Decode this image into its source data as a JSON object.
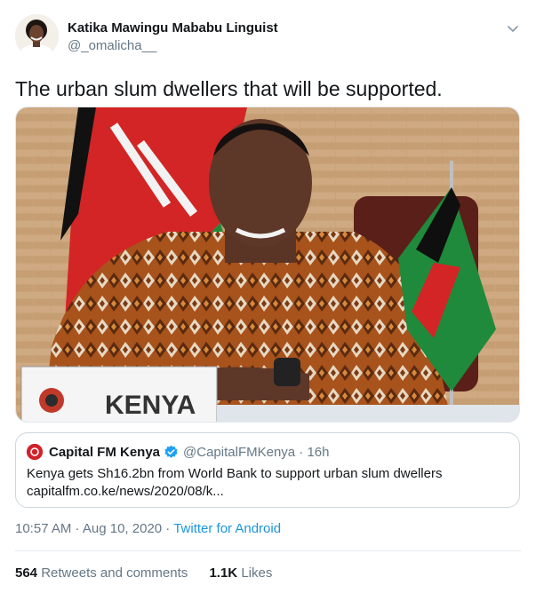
{
  "author": {
    "display_name": "Katika Mawingu Mababu Linguist",
    "handle": "@_omalicha__"
  },
  "tweet": {
    "text": "The urban slum dwellers that will be supported.",
    "image_placard_text": "KENYA"
  },
  "quoted_tweet": {
    "name": "Capital FM Kenya",
    "handle_time": "@CapitalFMKenya · 16h",
    "text": "Kenya gets Sh16.2bn from World Bank to support urban slum dwellers",
    "link": "capitalfm.co.ke/news/2020/08/k..."
  },
  "meta": {
    "timestamp": "10:57 AM · Aug 10, 2020 · ",
    "source": "Twitter for Android"
  },
  "stats": {
    "retweets_count": "564",
    "retweets_label": "Retweets and comments",
    "likes_count": "1.1K",
    "likes_label": "Likes"
  },
  "icons": [
    "avatar",
    "chevron-down-icon",
    "capital-fm-logo",
    "verified-badge-icon"
  ],
  "colors": {
    "link": "#1b95e0",
    "secondary_text": "#657786",
    "verified": "#1da1f2",
    "brand_red": "#d1222a"
  }
}
